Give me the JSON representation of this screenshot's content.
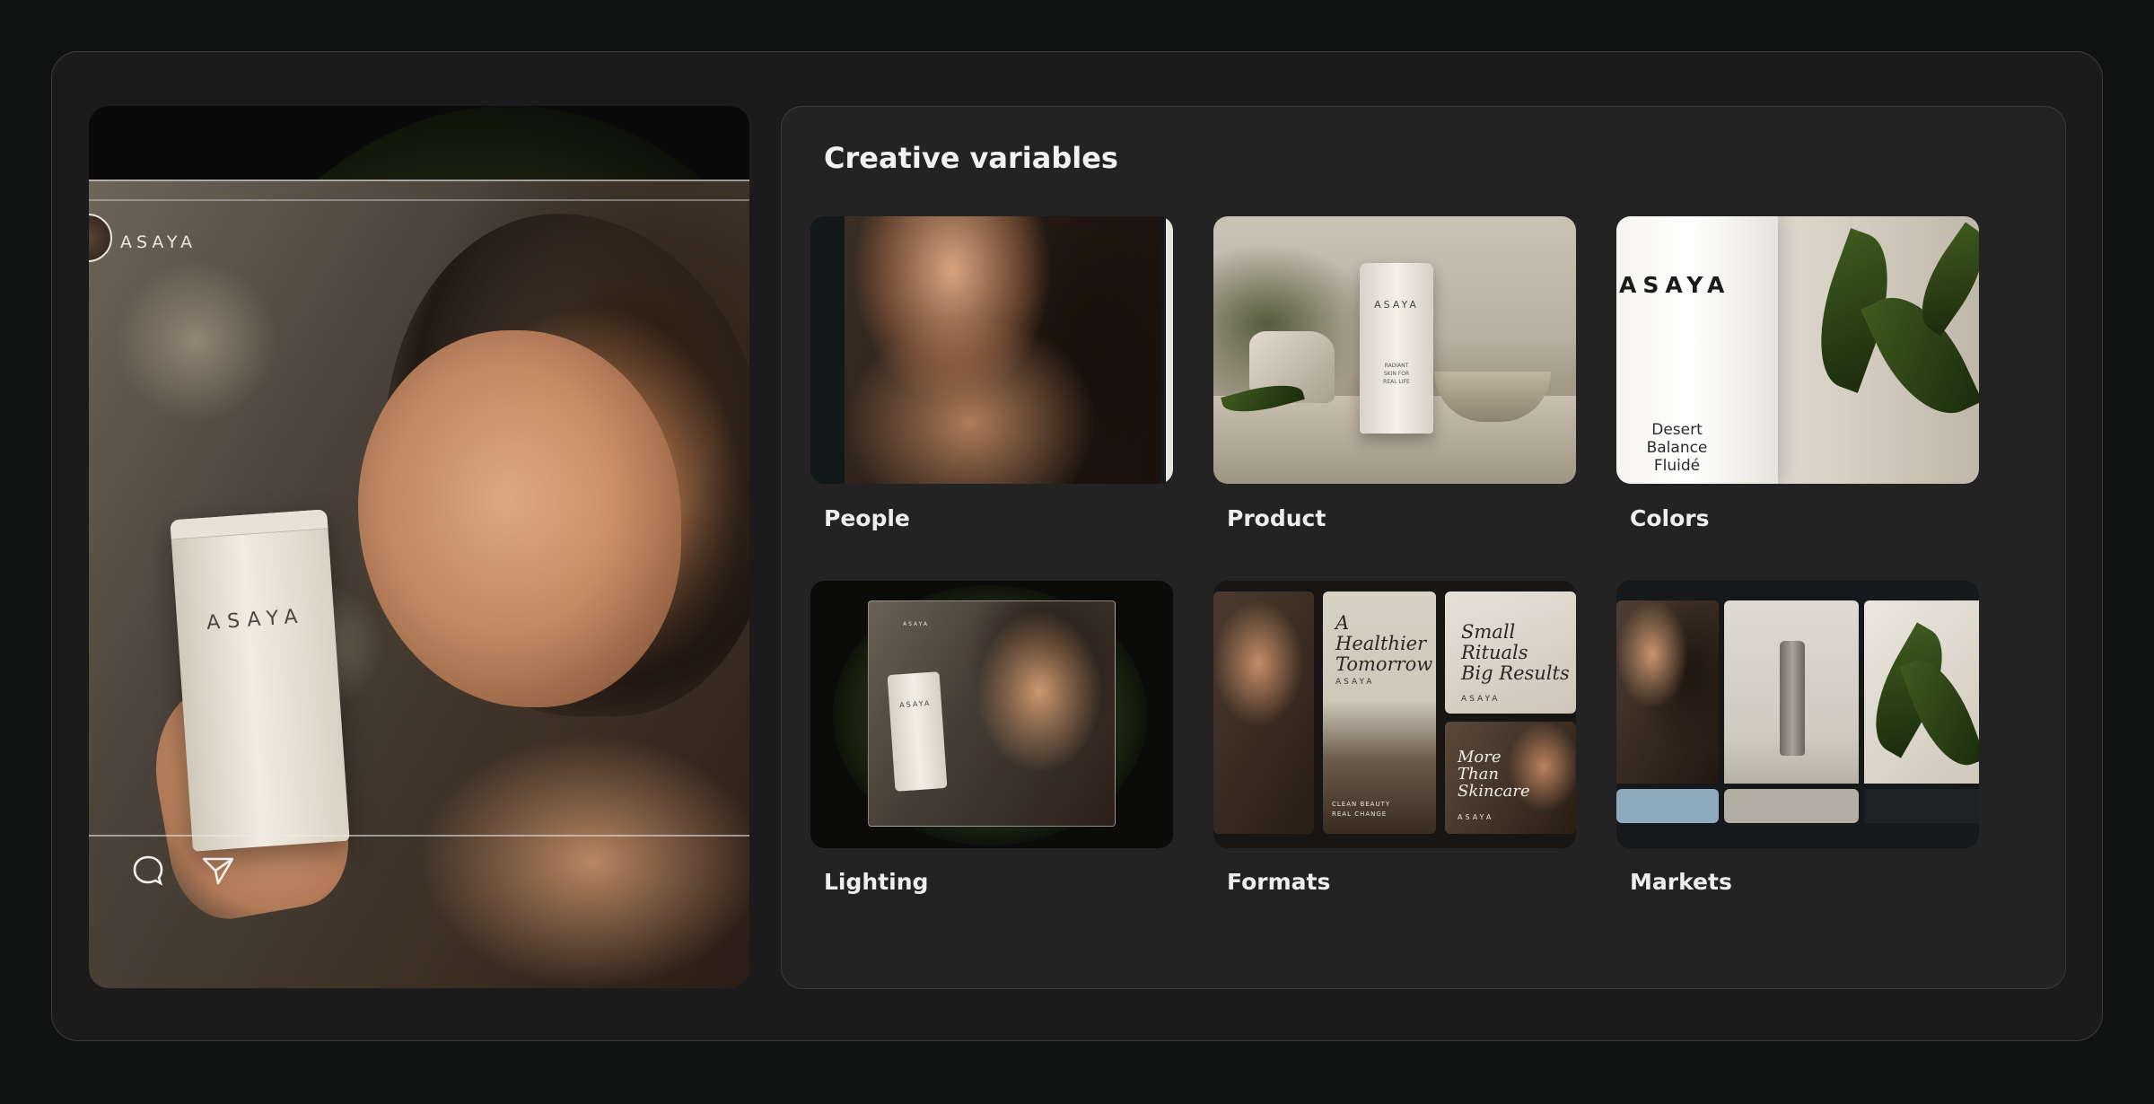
{
  "preview": {
    "brand": "ASAYA",
    "tube_brand": "ASAYA",
    "icons": [
      "comment-icon",
      "send-icon"
    ]
  },
  "panel": {
    "title": "Creative variables"
  },
  "cards": [
    {
      "label": "People"
    },
    {
      "label": "Product",
      "tube_brand": "ASAYA",
      "tube_desc": "RADIANT\nSKIN FOR\nREAL LIFE"
    },
    {
      "label": "Colors",
      "brand": "ASAYA",
      "product_name": "Desert\nBalance\nFluidé"
    },
    {
      "label": "Lighting",
      "brand": "ASAYA",
      "tube_brand": "ASAYA"
    },
    {
      "label": "Formats",
      "story_title": "A\nHealthier\nTomorrow",
      "story_brand": "ASAYA",
      "story_tag": "CLEAN BEAUTY\nREAL CHANGE",
      "square_title": "Small\nRituals\nBig Results",
      "square_brand": "ASAYA",
      "small_title": "More\nThan\nSkincare",
      "small_brand": "ASAYA"
    },
    {
      "label": "Markets"
    }
  ],
  "colors": {
    "background": "#101111",
    "panel": "#232323",
    "accent_glow": "#2b3418"
  }
}
